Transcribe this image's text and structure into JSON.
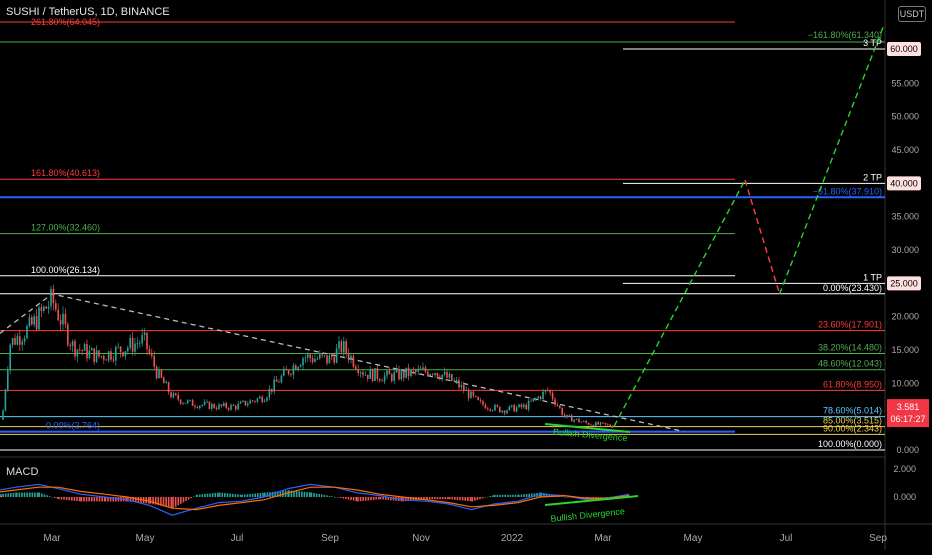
{
  "header": {
    "title": "SUSHI / TetherUS, 1D, BINANCE",
    "currency_badge": "USDT",
    "indicator_title": "MACD"
  },
  "colors": {
    "background": "#000000",
    "red": "#ff3b3b",
    "green": "#4caf50",
    "white": "#ffffff",
    "blue": "#2962ff",
    "lightblue": "#5ec8ff",
    "yellow": "#f0d050",
    "current_price": "#f23645"
  },
  "chart_data": [
    {
      "type": "candlestick",
      "title": "SUSHI / TetherUS, 1D, BINANCE",
      "x_axis": {
        "tick_labels": [
          "Mar",
          "May",
          "Jul",
          "Sep",
          "Nov",
          "2022",
          "Mar",
          "May",
          "Jul",
          "Sep"
        ]
      },
      "y_axis": {
        "side": "right",
        "range": [
          0,
          61.5
        ],
        "tick_values": [
          0,
          5,
          10,
          15,
          20,
          25,
          30,
          35,
          40,
          45,
          50,
          55,
          60
        ],
        "tick_labels": [
          "0.000",
          "5.000",
          "10.000",
          "15.000",
          "20.000",
          "25.000",
          "30.000",
          "35.000",
          "40.000",
          "45.000",
          "50.000",
          "55.000",
          "60.000"
        ]
      },
      "current_price": {
        "value": 3.581,
        "label": "3.581",
        "countdown": "06:17:27"
      },
      "price_series": {
        "dates": [
          "2021-01-01",
          "2021-02-01",
          "2021-02-15",
          "2021-03-01",
          "2021-03-15",
          "2021-04-01",
          "2021-04-15",
          "2021-05-01",
          "2021-05-10",
          "2021-05-20",
          "2021-06-01",
          "2021-06-20",
          "2021-07-01",
          "2021-07-20",
          "2021-08-01",
          "2021-08-15",
          "2021-09-01",
          "2021-09-10",
          "2021-09-25",
          "2021-10-10",
          "2021-10-25",
          "2021-11-10",
          "2021-11-25",
          "2021-12-10",
          "2021-12-25",
          "2022-01-10",
          "2022-01-25",
          "2022-02-05",
          "2022-02-20",
          "2022-03-10"
        ],
        "closes": [
          4.5,
          16.0,
          18.5,
          22.5,
          15.5,
          14.0,
          15.0,
          16.5,
          11.5,
          8.0,
          7.0,
          6.5,
          6.5,
          8.0,
          11.0,
          14.0,
          13.5,
          15.5,
          11.5,
          11.0,
          11.5,
          12.0,
          10.0,
          7.0,
          6.0,
          6.5,
          9.0,
          5.0,
          4.0,
          3.6
        ]
      },
      "levels": [
        {
          "label": "261.80%(64.045)",
          "value": 64.045,
          "color": "red",
          "side": "left"
        },
        {
          "label": "161.80%(40.613)",
          "value": 40.613,
          "color": "red",
          "side": "left"
        },
        {
          "label": "127.00%(32.460)",
          "value": 32.46,
          "color": "green",
          "side": "left"
        },
        {
          "label": "100.00%(26.134)",
          "value": 26.134,
          "color": "white",
          "side": "left"
        },
        {
          "label": "0.00%(23.430)",
          "value": 23.43,
          "color": "white",
          "side": "right"
        },
        {
          "label": "23.60%(17.901)",
          "value": 17.901,
          "color": "red",
          "side": "right"
        },
        {
          "label": "38.20%(14.480)",
          "value": 14.48,
          "color": "green",
          "side": "right"
        },
        {
          "label": "48.60%(12.043)",
          "value": 12.043,
          "color": "green",
          "side": "right"
        },
        {
          "label": "61.80%(8.950)",
          "value": 8.95,
          "color": "red",
          "side": "right"
        },
        {
          "label": "78.60%(5.014)",
          "value": 5.014,
          "color": "lightblue",
          "side": "right"
        },
        {
          "label": "85.00%(3.515)",
          "value": 3.515,
          "color": "yellow",
          "side": "right"
        },
        {
          "label": "90.00%(2.343)",
          "value": 2.343,
          "color": "yellow",
          "side": "right"
        },
        {
          "label": "100.00%(0.000)",
          "value": 0.0,
          "color": "white",
          "side": "right"
        },
        {
          "label": "−161.80%(61.340)",
          "value": 61.34,
          "color": "green",
          "side": "right"
        },
        {
          "label": "−61.80%(37.910)",
          "value": 37.91,
          "color": "blue",
          "side": "right"
        },
        {
          "label": "0.00%(2.764)",
          "value": 2.764,
          "color": "blue",
          "side": "left"
        }
      ],
      "targets": [
        {
          "label": "3 TP",
          "value": 60.0
        },
        {
          "label": "2 TP",
          "value": 40.0
        },
        {
          "label": "1 TP",
          "value": 25.0
        }
      ],
      "right_axis_tags": [
        {
          "label": "60.000",
          "value": 60.0
        },
        {
          "label": "40.000",
          "value": 40.0
        },
        {
          "label": "25.000",
          "value": 25.0
        }
      ],
      "projection": {
        "dates": [
          "2022-03-10",
          "2022-06-05",
          "2022-06-28",
          "2022-09-05"
        ],
        "values": [
          3.6,
          40.5,
          23.4,
          63.5
        ]
      },
      "trendline": {
        "dates": [
          "2021-01-01",
          "2021-03-01",
          "2022-04-25"
        ],
        "values": [
          17.5,
          23.4,
          2.8
        ]
      },
      "annotations": [
        {
          "text": "Bullish Divergence",
          "date": "2022-02-20",
          "value": 2.0
        }
      ]
    },
    {
      "type": "line",
      "title": "MACD",
      "y_axis": {
        "tick_values": [
          2.0,
          0.0
        ],
        "tick_labels": [
          "2.000",
          "0.000"
        ]
      },
      "macd_series": {
        "dates": [
          "2021-01-01",
          "2021-01-20",
          "2021-02-05",
          "2021-02-20",
          "2021-03-05",
          "2021-03-20",
          "2021-04-05",
          "2021-04-20",
          "2021-05-05",
          "2021-05-20",
          "2021-06-05",
          "2021-06-20",
          "2021-07-05",
          "2021-07-20",
          "2021-08-05",
          "2021-08-20",
          "2021-09-05",
          "2021-09-20",
          "2021-10-05",
          "2021-10-20",
          "2021-11-05",
          "2021-11-20",
          "2021-12-05",
          "2021-12-20",
          "2022-01-05",
          "2022-01-20",
          "2022-02-05",
          "2022-02-20",
          "2022-03-05",
          "2022-03-20"
        ],
        "macd": [
          0.1,
          0.4,
          0.7,
          0.9,
          0.6,
          0.2,
          0.0,
          -0.2,
          -0.6,
          -1.3,
          -0.8,
          -0.4,
          -0.3,
          0.0,
          0.6,
          0.9,
          0.7,
          0.3,
          0.1,
          -0.2,
          -0.3,
          -0.5,
          -0.9,
          -0.5,
          -0.3,
          0.2,
          0.1,
          -0.2,
          -0.1,
          0.2
        ],
        "signal": [
          0.0,
          0.3,
          0.5,
          0.7,
          0.7,
          0.4,
          0.2,
          0.0,
          -0.3,
          -0.8,
          -0.9,
          -0.6,
          -0.4,
          -0.2,
          0.3,
          0.7,
          0.7,
          0.5,
          0.2,
          0.0,
          -0.2,
          -0.4,
          -0.7,
          -0.6,
          -0.4,
          0.0,
          0.1,
          -0.1,
          -0.1,
          0.1
        ]
      },
      "annotations": [
        {
          "text": "Bullish Divergence",
          "date": "2022-02-25",
          "value": -1.0
        }
      ]
    }
  ]
}
